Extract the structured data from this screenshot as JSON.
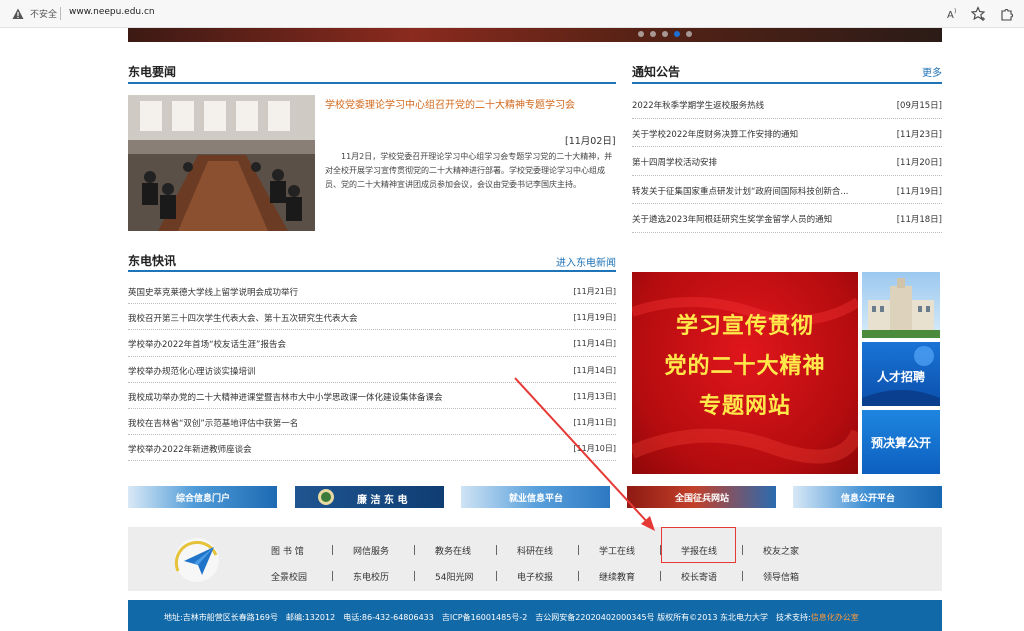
{
  "browser": {
    "insecure_label": "不安全",
    "url": "www.neepu.edu.cn"
  },
  "news": {
    "section_title": "东电要闻",
    "headline": "学校党委理论学习中心组召开党的二十大精神专题学习会",
    "date": "[11月02日]",
    "summary": "11月2日，学校党委召开理论学习中心组学习会专题学习党的二十大精神，并对全校开展学习宣传贯彻党的二十大精神进行部署。学校党委理论学习中心组成员、党的二十大精神宣讲团成员参加会议，会议由党委书记李国庆主持。"
  },
  "notices": {
    "section_title": "通知公告",
    "more_label": "更多",
    "items": [
      {
        "title": "2022年秋季学期学生返校服务热线",
        "date": "[09月15日]"
      },
      {
        "title": "关于学校2022年度财务决算工作安排的通知",
        "date": "[11月23日]"
      },
      {
        "title": "第十四周学校活动安排",
        "date": "[11月20日]"
      },
      {
        "title": "转发关于征集国家重点研发计划“政府间国际科技创新合...",
        "date": "[11月19日]"
      },
      {
        "title": "关于遴选2023年阿根廷研究生奖学金留学人员的通知",
        "date": "[11月18日]"
      }
    ]
  },
  "flash": {
    "section_title": "东电快讯",
    "more_label": "进入东电新闻",
    "items": [
      {
        "title": "英国史萃克莱德大学线上留学说明会成功举行",
        "date": "[11月21日]"
      },
      {
        "title": "我校召开第三十四次学生代表大会、第十五次研究生代表大会",
        "date": "[11月19日]"
      },
      {
        "title": "学校举办2022年首场“校友话生涯”报告会",
        "date": "[11月14日]"
      },
      {
        "title": "学校举办规范化心理访谈实操培训",
        "date": "[11月14日]"
      },
      {
        "title": "我校成功举办党的二十大精神进课堂暨吉林市大中小学思政课一体化建设集体备课会",
        "date": "[11月13日]"
      },
      {
        "title": "我校在吉林省“双创”示范基地评估中获第一名",
        "date": "[11月11日]"
      },
      {
        "title": "学校举办2022年新进教师座谈会",
        "date": "[11月10日]"
      }
    ]
  },
  "banner": {
    "line1": "学习宣传贯彻",
    "line2": "党的二十大精神",
    "line3": "专题网站"
  },
  "tiles": {
    "talent": "人才招聘",
    "budget": "预决算公开"
  },
  "link_banners": {
    "portal": "综合信息门户",
    "clean": "廉 洁 东 电",
    "employment": "就业信息平台",
    "recruit": "全国征兵网站",
    "disclosure": "信息公开平台"
  },
  "quick_links": {
    "row1": [
      "图 书 馆",
      "网信服务",
      "教务在线",
      "科研在线",
      "学工在线",
      "学报在线",
      "校友之家"
    ],
    "row2": [
      "全景校园",
      "东电校历",
      "54阳光网",
      "电子校报",
      "继续教育",
      "校长寄语",
      "领导信箱"
    ]
  },
  "footer": {
    "text": "地址:吉林市船营区长春路169号　邮编:132012　电话:86-432-64806433　吉ICP备16001485号-2　吉公网安备22020402000345号 版权所有©2013 东北电力大学　技术支持:",
    "support": "信息化办公室"
  },
  "colors": {
    "accent": "#1f73b7",
    "headline": "#d2691e",
    "banner_red": "#d0121a",
    "banner_text": "#ffe94a",
    "footer_bg": "#1269a8",
    "annotation": "#e53935"
  }
}
